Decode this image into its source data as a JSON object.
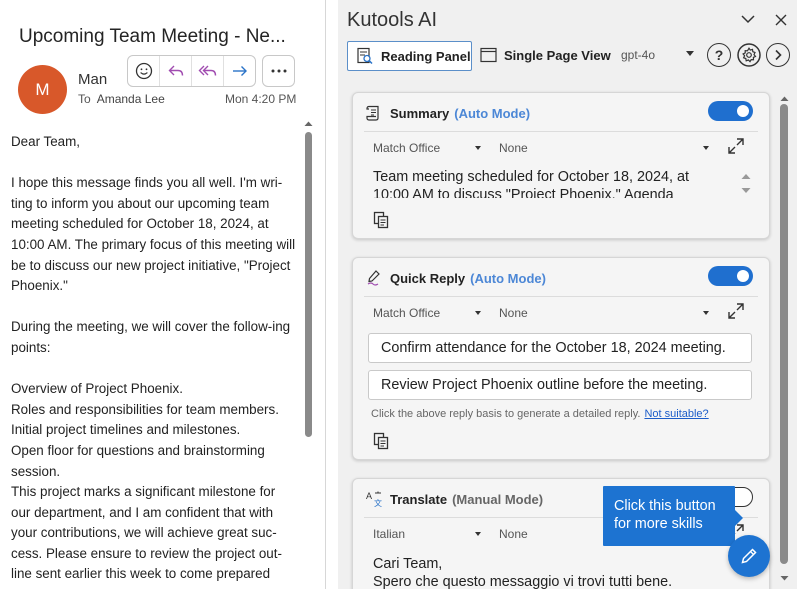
{
  "email": {
    "subject": "Upcoming Team Meeting - Ne...",
    "avatar_initial": "M",
    "avatar_color": "#d8582a",
    "sender": "Man",
    "to_label": "To",
    "recipient": "Amanda Lee",
    "time": "Mon 4:20 PM",
    "actions": [
      "emoji-icon",
      "reply-icon",
      "reply-all-icon",
      "forward-icon",
      "more-icon"
    ],
    "body": {
      "greeting": "Dear Team,",
      "para1": "I hope this message finds you all well. I'm wri-ting to inform you about our upcoming team meeting scheduled for October 18, 2024, at 10:00 AM. The primary focus of this meeting will be to discuss our new project initiative, \"Project Phoenix.\"",
      "para2": "During the meeting, we will cover the follow-ing points:",
      "points": [
        "Overview of Project Phoenix.",
        "Roles and responsibilities for team members.",
        "Initial project timelines and milestones.",
        "Open floor for questions and brainstorming session."
      ],
      "para3": "This project marks a significant milestone for our department, and I am confident that with your contributions, we will achieve great suc-cess. Please ensure to review the project out-line sent earlier this week to come prepared"
    }
  },
  "kutools": {
    "title": "Kutools AI",
    "tabs": {
      "reading": "Reading Panel",
      "single": "Single Page View"
    },
    "model": "gpt-4o",
    "help_label": "?",
    "accent_color": "#1f6fcf",
    "summary": {
      "title": "Summary",
      "mode": "(Auto Mode)",
      "language": "Match Office",
      "style": "None",
      "text": "Team meeting scheduled for October 18, 2024, at 10:00 AM to discuss \"Project Phoenix.\" Agenda"
    },
    "quick_reply": {
      "title": "Quick Reply",
      "mode": "(Auto Mode)",
      "language": "Match Office",
      "style": "None",
      "options": [
        "Confirm attendance for the October 18, 2024 meeting.",
        "Review Project Phoenix outline before the meeting."
      ],
      "hint": "Click the above reply basis to generate a detailed reply.",
      "hint_link": "Not suitable?"
    },
    "translate": {
      "title": "Translate",
      "mode": "(Manual Mode)",
      "language": "Italian",
      "style": "None",
      "line1": "Cari Team,",
      "line2": "Spero che questo messaggio vi trovi tutti bene."
    },
    "tooltip": "Click this button for more skills"
  }
}
